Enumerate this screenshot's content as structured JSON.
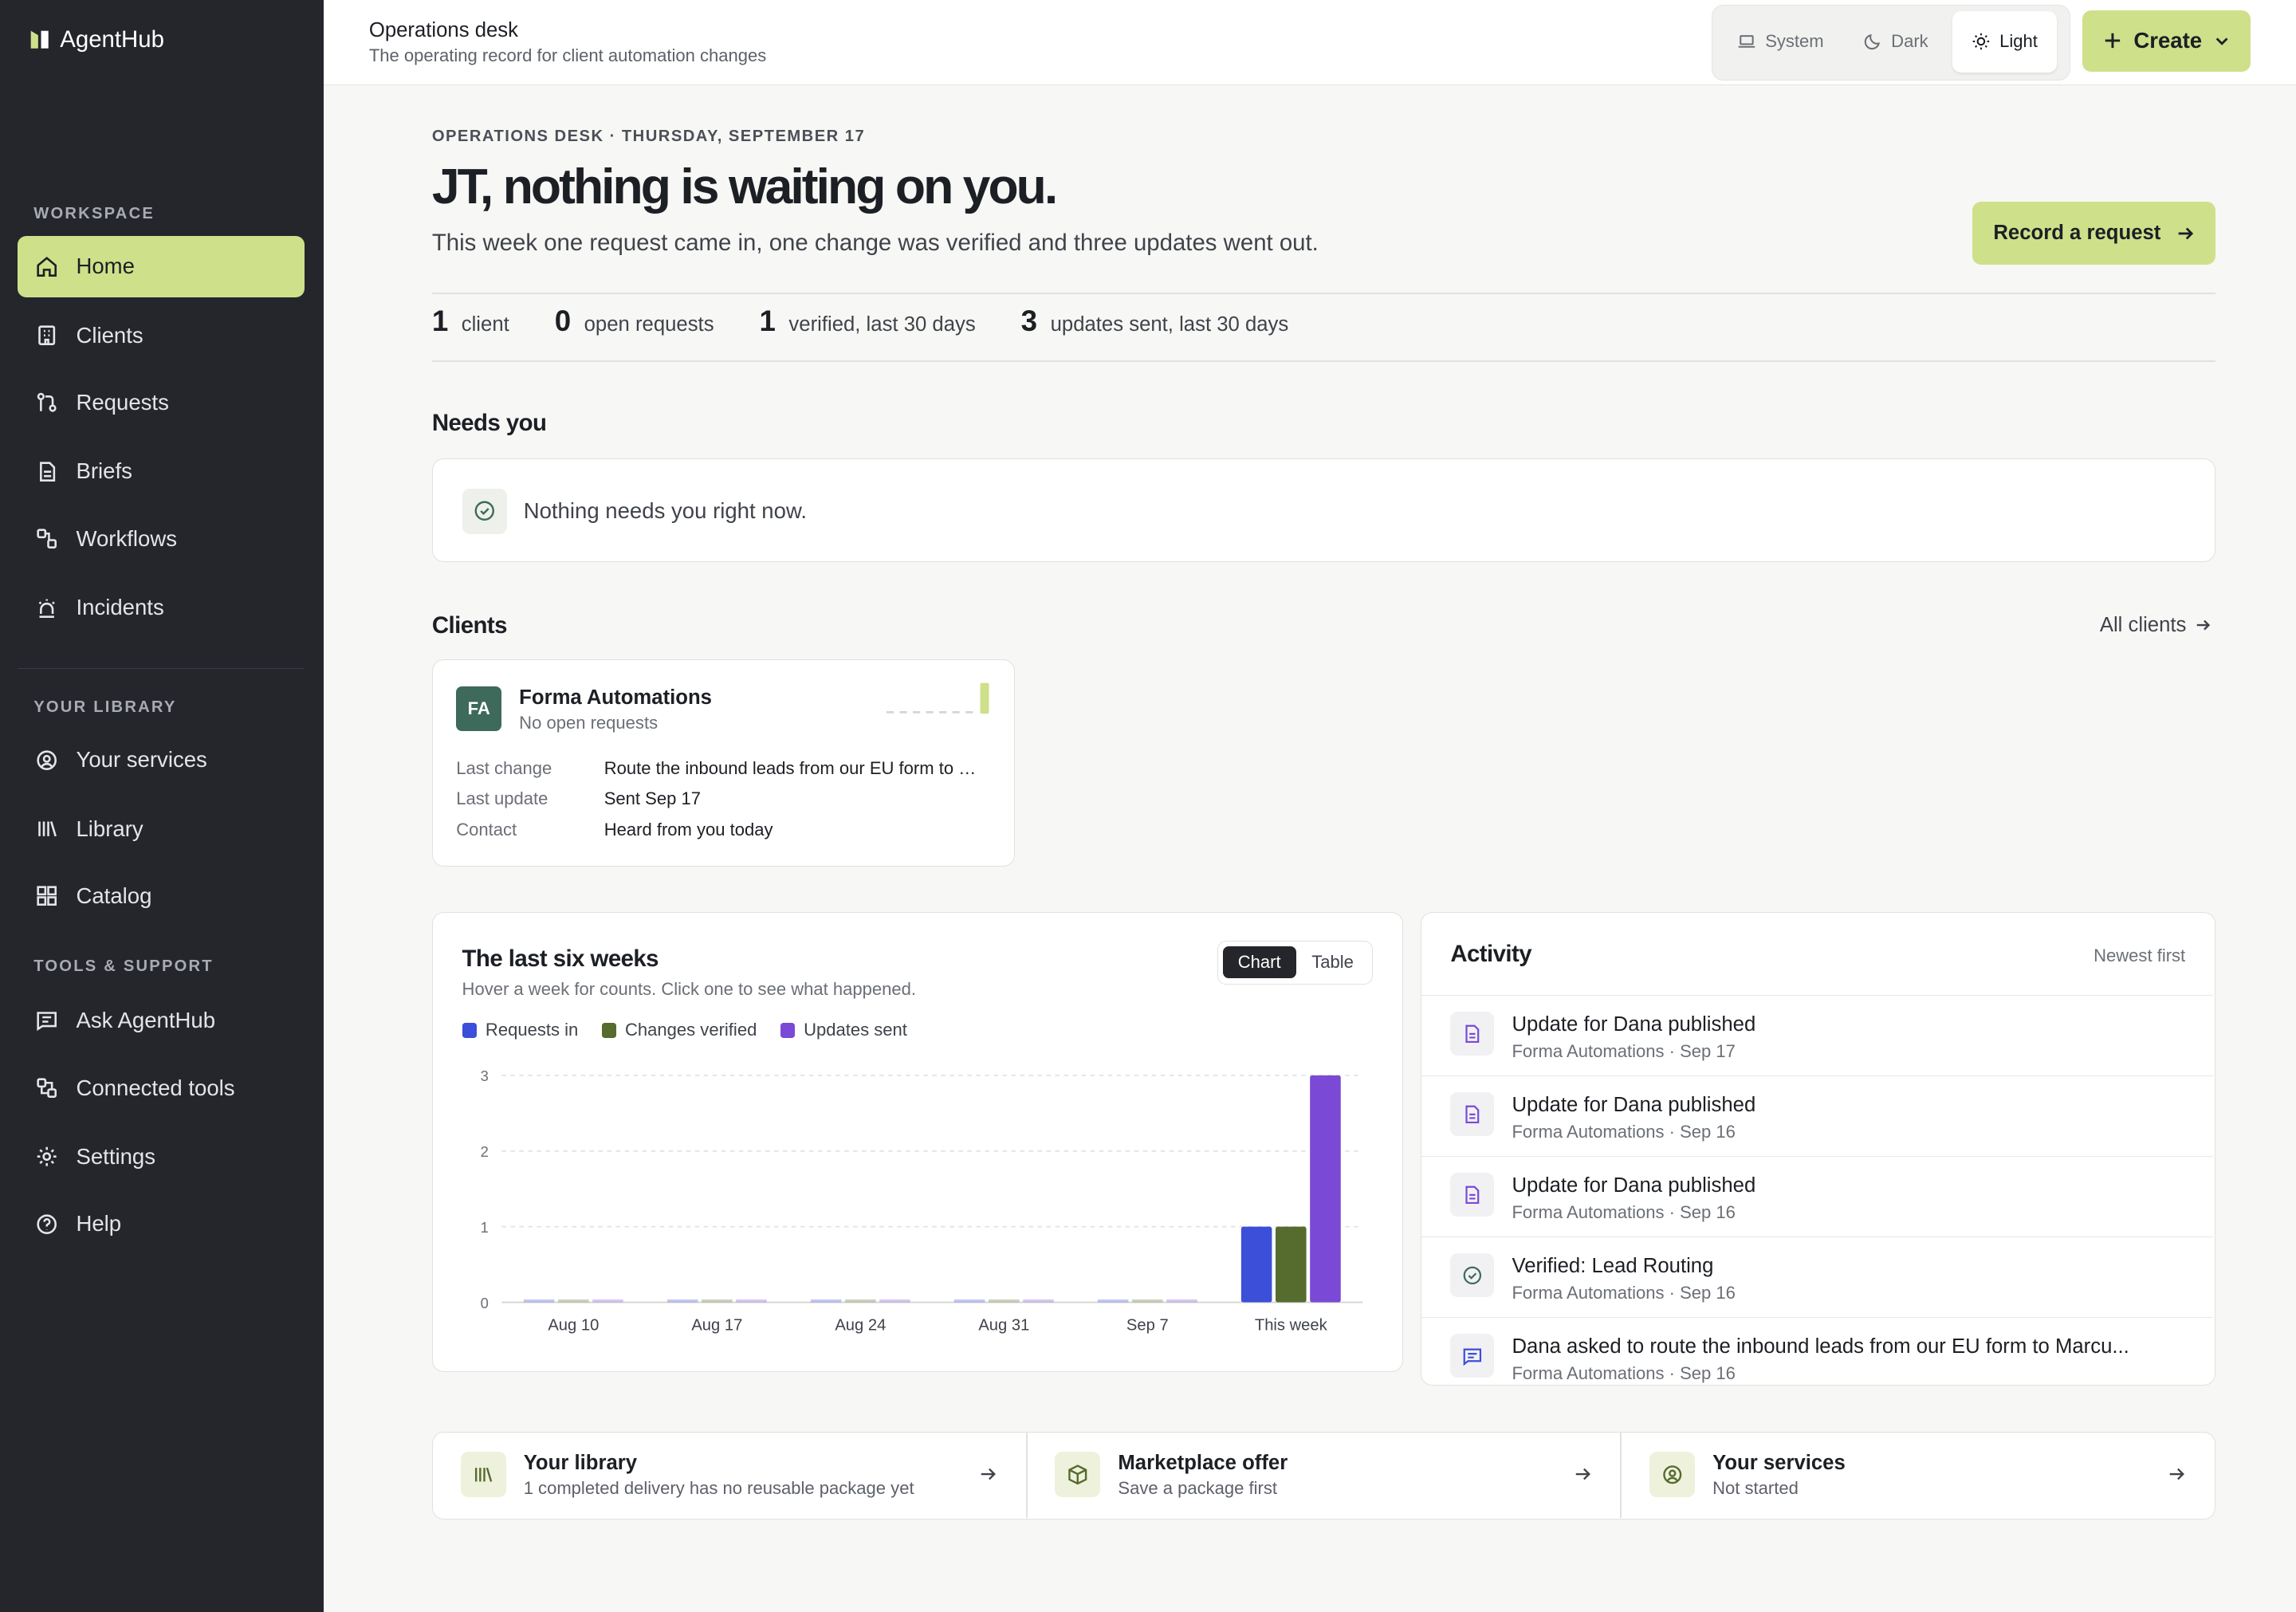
{
  "app": {
    "name": "AgentHub"
  },
  "sidebar": {
    "sections": [
      "WORKSPACE",
      "YOUR LIBRARY",
      "TOOLS & SUPPORT"
    ],
    "workspace": [
      {
        "label": "Home",
        "icon": "home-icon"
      },
      {
        "label": "Clients",
        "icon": "building-icon"
      },
      {
        "label": "Requests",
        "icon": "git-pull-icon"
      },
      {
        "label": "Briefs",
        "icon": "file-icon"
      },
      {
        "label": "Workflows",
        "icon": "workflow-icon"
      },
      {
        "label": "Incidents",
        "icon": "siren-icon"
      }
    ],
    "library": [
      {
        "label": "Your services",
        "icon": "user-circle-icon"
      },
      {
        "label": "Library",
        "icon": "library-icon"
      },
      {
        "label": "Catalog",
        "icon": "grid-icon"
      }
    ],
    "tools": [
      {
        "label": "Ask AgentHub",
        "icon": "message-icon"
      },
      {
        "label": "Connected tools",
        "icon": "plug-icon"
      },
      {
        "label": "Settings",
        "icon": "gear-icon"
      },
      {
        "label": "Help",
        "icon": "help-icon"
      }
    ]
  },
  "topbar": {
    "title": "Operations desk",
    "subtitle": "The operating record for client automation changes",
    "theme": {
      "system": "System",
      "dark": "Dark",
      "light": "Light",
      "selected": "Light"
    },
    "create_label": "Create"
  },
  "hero": {
    "eyebrow": "OPERATIONS DESK · THURSDAY, SEPTEMBER 17",
    "headline": "JT, nothing is waiting on you.",
    "lede": "This week one request came in, one change was verified and three updates went out.",
    "record_label": "Record a request"
  },
  "stats": [
    {
      "num": "1",
      "label": "client"
    },
    {
      "num": "0",
      "label": "open requests"
    },
    {
      "num": "1",
      "label": "verified, last 30 days"
    },
    {
      "num": "3",
      "label": "updates sent, last 30 days"
    }
  ],
  "needs_you": {
    "title": "Needs you",
    "empty": "Nothing needs you right now."
  },
  "clients": {
    "title": "Clients",
    "all_label": "All clients",
    "card": {
      "initials": "FA",
      "name": "Forma Automations",
      "status": "No open requests",
      "rows": [
        {
          "k": "Last change",
          "v": "Route the inbound leads from our EU form to Marcus"
        },
        {
          "k": "Last update",
          "v": "Sent Sep 17"
        },
        {
          "k": "Contact",
          "v": "Heard from you today"
        }
      ]
    }
  },
  "weekly": {
    "title": "The last six weeks",
    "subtitle": "Hover a week for counts. Click one to see what happened.",
    "chart_label": "Chart",
    "table_label": "Table"
  },
  "chart_data": {
    "type": "bar",
    "categories": [
      "Aug 10",
      "Aug 17",
      "Aug 24",
      "Aug 31",
      "Sep 7",
      "This week"
    ],
    "series": [
      {
        "name": "Requests in",
        "color": "#3b4fd8",
        "values": [
          0,
          0,
          0,
          0,
          0,
          1
        ]
      },
      {
        "name": "Changes verified",
        "color": "#566b2e",
        "values": [
          0,
          0,
          0,
          0,
          0,
          1
        ]
      },
      {
        "name": "Updates sent",
        "color": "#7a4ad6",
        "values": [
          0,
          0,
          0,
          0,
          0,
          3
        ]
      }
    ],
    "ylim": [
      0,
      3
    ],
    "yticks": [
      "0",
      "1",
      "2",
      "3"
    ],
    "legend": "top-left",
    "grid": true
  },
  "activity": {
    "title": "Activity",
    "sort": "Newest first",
    "items": [
      {
        "text": "Update for Dana published",
        "meta": "Forma Automations · Sep 17",
        "icon": "document-icon"
      },
      {
        "text": "Update for Dana published",
        "meta": "Forma Automations · Sep 16",
        "icon": "document-icon"
      },
      {
        "text": "Update for Dana published",
        "meta": "Forma Automations · Sep 16",
        "icon": "document-icon"
      },
      {
        "text": "Verified: Lead Routing",
        "meta": "Forma Automations · Sep 16",
        "icon": "check-circle-icon"
      },
      {
        "text": "Dana asked to route the inbound leads from our EU form to Marcu...",
        "meta": "Forma Automations · Sep 16",
        "icon": "message-icon"
      }
    ]
  },
  "tiles": [
    {
      "title": "Your library",
      "sub": "1 completed delivery has no reusable package yet",
      "icon": "library-icon"
    },
    {
      "title": "Marketplace offer",
      "sub": "Save a package first",
      "icon": "package-icon"
    },
    {
      "title": "Your services",
      "sub": "Not started",
      "icon": "user-circle-icon"
    }
  ],
  "colors": {
    "accent": "#cfe08a",
    "sidebar": "#24262b"
  }
}
